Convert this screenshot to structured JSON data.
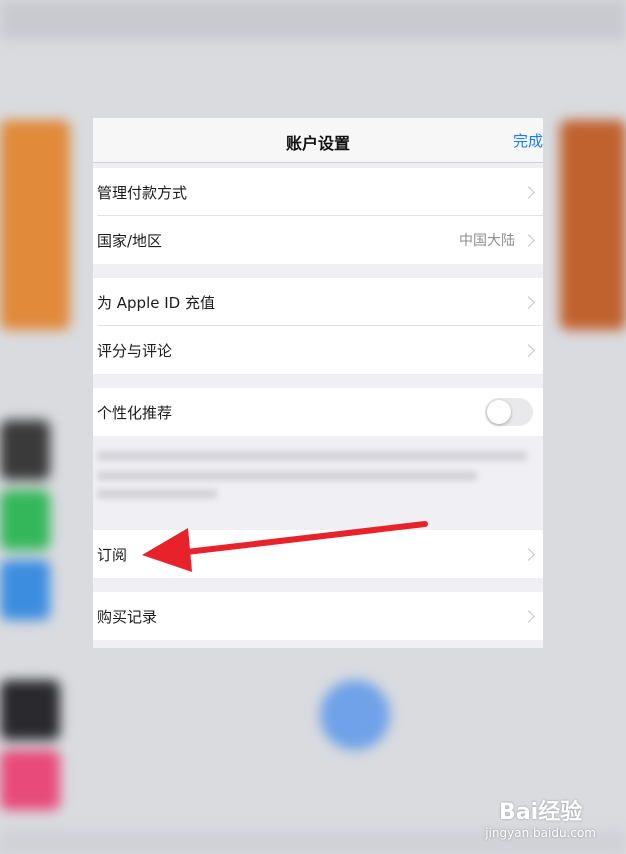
{
  "nav": {
    "title": "账户设置",
    "done": "完成"
  },
  "groups": [
    {
      "rows": [
        {
          "label": "管理付款方式",
          "value": ""
        },
        {
          "label": "国家/地区",
          "value": "中国大陆"
        }
      ]
    },
    {
      "rows": [
        {
          "label": "为 Apple ID 充值",
          "value": ""
        },
        {
          "label": "评分与评论",
          "value": ""
        }
      ]
    },
    {
      "rows": [
        {
          "label": "个性化推荐",
          "toggle": false
        }
      ]
    },
    {
      "rows": [
        {
          "label": "订阅",
          "value": ""
        }
      ]
    },
    {
      "rows": [
        {
          "label": "购买记录",
          "value": ""
        }
      ]
    }
  ],
  "annotation": {
    "arrow_color": "#e8222a",
    "points_to": "订阅"
  },
  "watermark": {
    "brand": "Bai经验",
    "site": "jingyan.baidu.com"
  },
  "colors": {
    "accent": "#1a7cf5"
  }
}
